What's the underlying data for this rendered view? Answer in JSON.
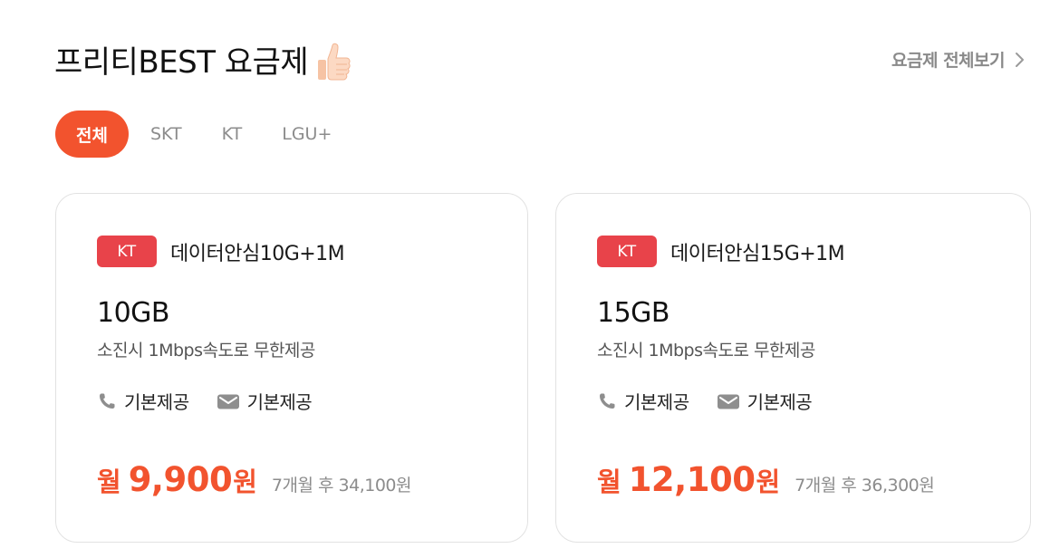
{
  "header": {
    "title": "프리티BEST 요금제",
    "thumb_icon": "thumbs-up-emoji",
    "view_all_label": "요금제 전체보기",
    "view_all_icon": "chevron-right-icon"
  },
  "tabs": [
    {
      "label": "전체",
      "active": true
    },
    {
      "label": "SKT",
      "active": false
    },
    {
      "label": "KT",
      "active": false
    },
    {
      "label": "LGU+",
      "active": false
    }
  ],
  "colors": {
    "accent": "#f2532e",
    "carrier_badge": "#e8434a",
    "muted_text": "#8c8c8c"
  },
  "plans": [
    {
      "carrier": "KT",
      "name": "데이터안심10G+1M",
      "data": "10GB",
      "data_desc": "소진시 1Mbps속도로 무한제공",
      "call_label": "기본제공",
      "call_icon": "phone-icon",
      "sms_label": "기본제공",
      "sms_icon": "envelope-icon",
      "price_prefix": "월",
      "price": "9,900",
      "price_suffix": "원",
      "after_price": "7개월 후 34,100원"
    },
    {
      "carrier": "KT",
      "name": "데이터안심15G+1M",
      "data": "15GB",
      "data_desc": "소진시 1Mbps속도로 무한제공",
      "call_label": "기본제공",
      "call_icon": "phone-icon",
      "sms_label": "기본제공",
      "sms_icon": "envelope-icon",
      "price_prefix": "월",
      "price": "12,100",
      "price_suffix": "원",
      "after_price": "7개월 후 36,300원"
    }
  ]
}
